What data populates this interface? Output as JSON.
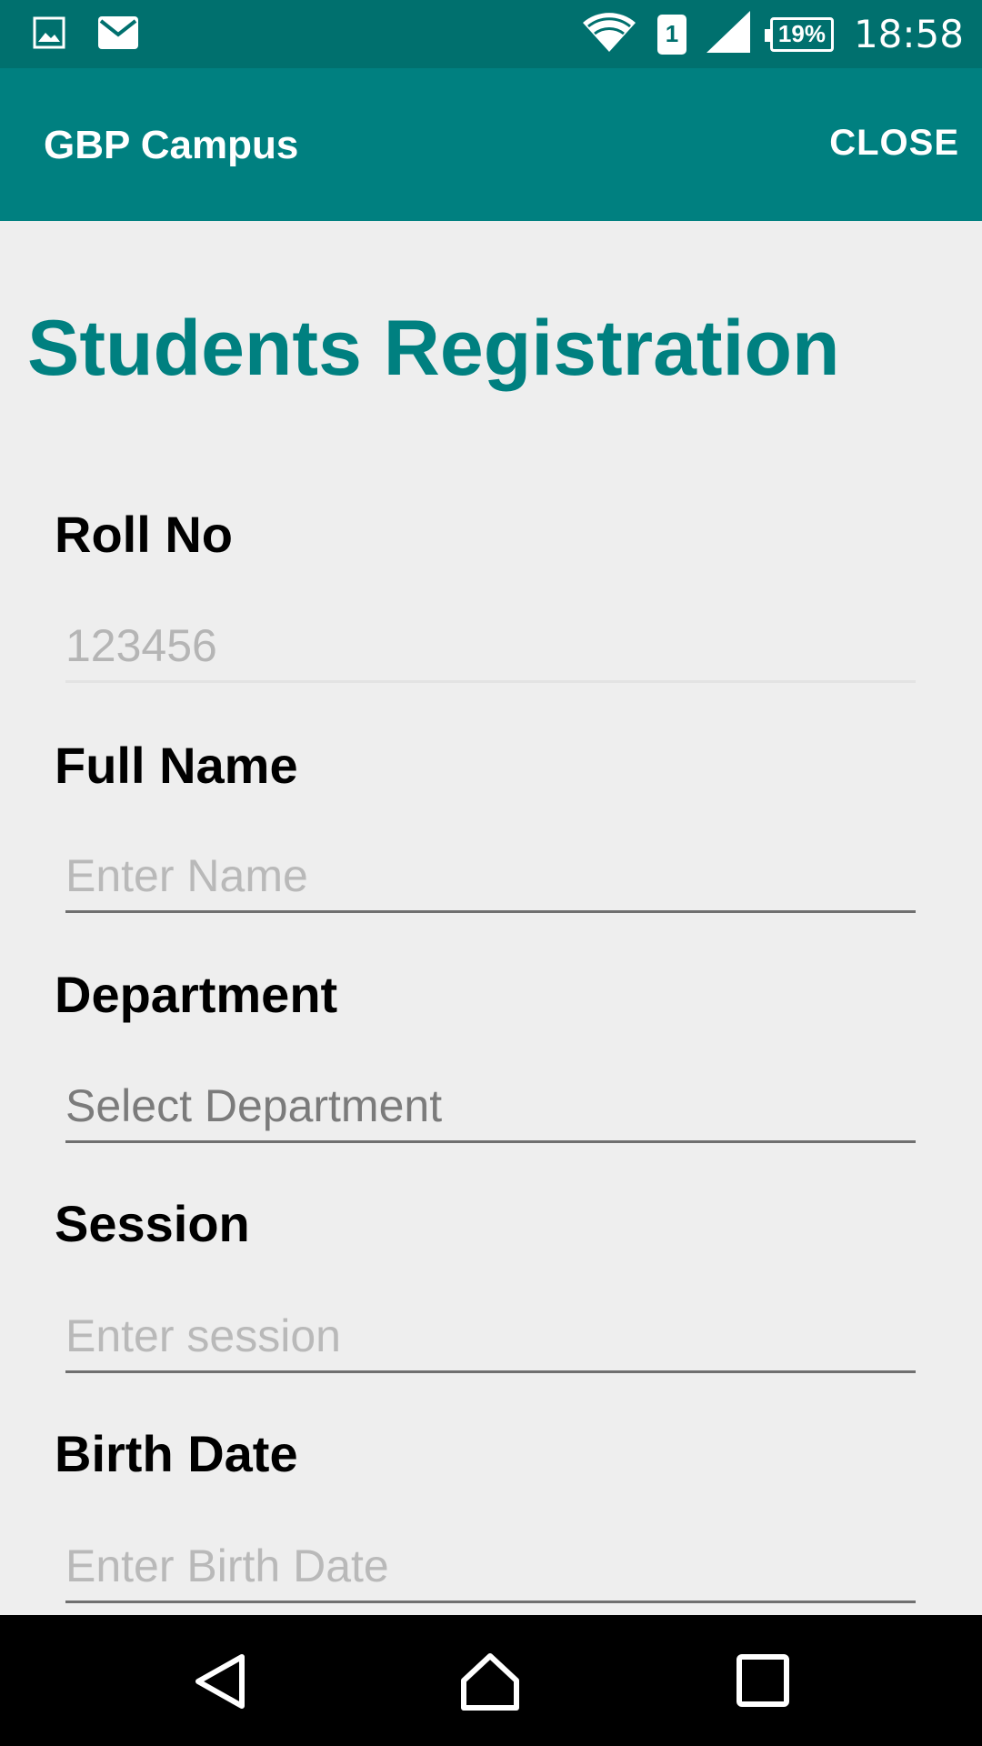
{
  "status_bar": {
    "notifications": [
      "image-icon",
      "mail-icon"
    ],
    "sim_slot": "1",
    "battery": "19%",
    "time": "18:58"
  },
  "app_bar": {
    "title": "GBP Campus",
    "close_label": "CLOSE"
  },
  "page": {
    "title": "Students Registration"
  },
  "form": {
    "roll_no": {
      "label": "Roll No",
      "value": "123456",
      "enabled": false
    },
    "full_name": {
      "label": "Full Name",
      "placeholder": "Enter Name"
    },
    "department": {
      "label": "Department",
      "value": "Select Department"
    },
    "session": {
      "label": "Session",
      "placeholder": "Enter session"
    },
    "birth_date": {
      "label": "Birth Date",
      "placeholder": "Enter Birth Date"
    }
  },
  "nav_bar": {
    "buttons": [
      "back-icon",
      "home-icon",
      "recents-icon"
    ]
  },
  "colors": {
    "primary": "#008080",
    "primary_dark": "#00706e",
    "background": "#eeeeee"
  }
}
